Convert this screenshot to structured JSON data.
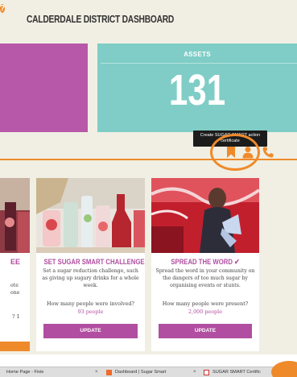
{
  "dashboard": {
    "title": "CALDERDALE DISTRICT DASHBOARD",
    "assets": {
      "label": "ASSETS",
      "value": "131"
    },
    "tooltip": "Create SUGAR SMART action certificate",
    "accent_color": "#ef8a2b",
    "brand_color": "#b14ea1",
    "teal_color": "#7fcdc6",
    "help_icon_text": "?"
  },
  "left_card": {
    "title_fragment": "EE",
    "desc_fragment": "ote\none",
    "question_fragment": "? 1"
  },
  "cards": [
    {
      "title": "SET SUGAR SMART CHALLENGES",
      "check": "✔",
      "description": "Set a sugar reduction challenge, such as giving up sugary drinks for a whole week.",
      "question": "How many people were involved?",
      "answer": "93 people",
      "button": "UPDATE"
    },
    {
      "title": "SPREAD THE WORD",
      "check": "✔",
      "description": "Spread the word in your community on the dangers of too much sugar by organising events or stunts.",
      "question": "How many people were present?",
      "answer": "2,000 people",
      "button": "UPDATE"
    }
  ],
  "taskbar": {
    "tabs": [
      {
        "label": "Home Page - Fixie",
        "close": "×"
      },
      {
        "label": "Dashboard | Sugar Smart",
        "close": "×"
      },
      {
        "label": "SUGAR SMART Certific"
      }
    ]
  }
}
